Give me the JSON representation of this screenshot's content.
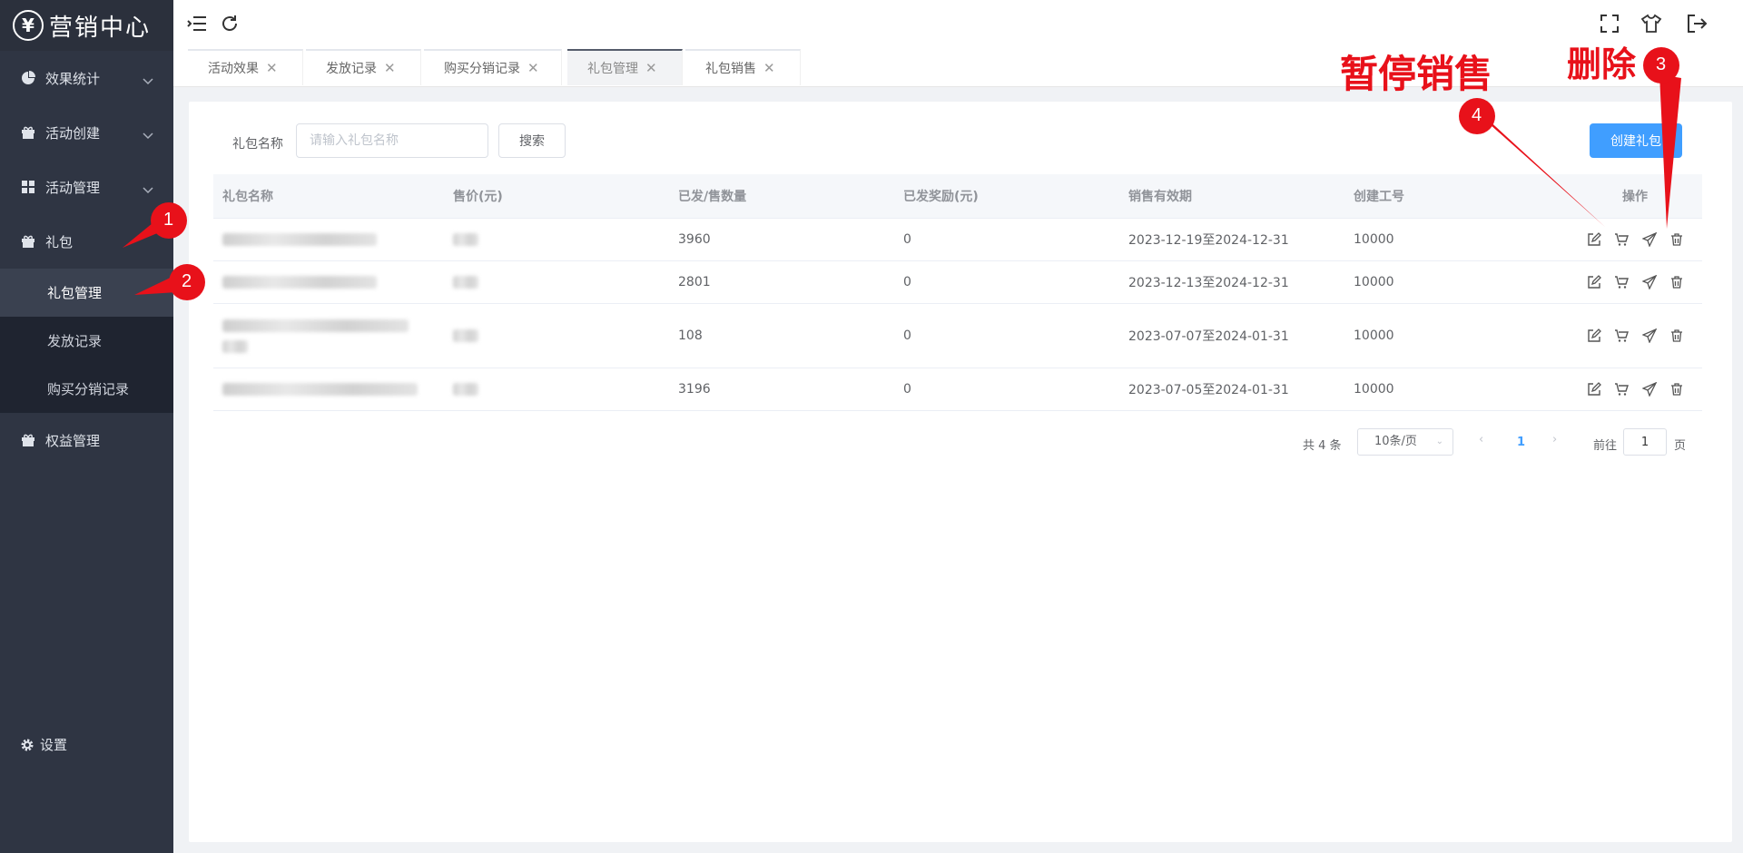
{
  "brand": {
    "logo_glyph": "¥",
    "title": "营销中心"
  },
  "sidebar": {
    "items": [
      {
        "label": "效果统计",
        "icon": "pie-chart-icon"
      },
      {
        "label": "活动创建",
        "icon": "gift-icon"
      },
      {
        "label": "活动管理",
        "icon": "grid-icon"
      },
      {
        "label": "礼包",
        "icon": "gift-icon"
      }
    ],
    "sub_items": [
      {
        "label": "礼包管理",
        "active": true
      },
      {
        "label": "发放记录"
      },
      {
        "label": "购买分销记录"
      }
    ],
    "extra_item": {
      "label": "权益管理",
      "icon": "gift-icon"
    },
    "settings_label": "设置"
  },
  "tabs": [
    {
      "label": "活动效果"
    },
    {
      "label": "发放记录"
    },
    {
      "label": "购买分销记录"
    },
    {
      "label": "礼包管理",
      "active": true
    },
    {
      "label": "礼包销售"
    }
  ],
  "search": {
    "label": "礼包名称",
    "placeholder": "请输入礼包名称",
    "button_label": "搜索",
    "create_label": "创建礼包"
  },
  "table": {
    "columns": [
      "礼包名称",
      "售价(元)",
      "已发/售数量",
      "已发奖励(元)",
      "销售有效期",
      "创建工号",
      "操作"
    ],
    "rows": [
      {
        "sold": "3960",
        "reward": "0",
        "period": "2023-12-19至2024-12-31",
        "creator": "10000"
      },
      {
        "sold": "2801",
        "reward": "0",
        "period": "2023-12-13至2024-12-31",
        "creator": "10000"
      },
      {
        "sold": "108",
        "reward": "0",
        "period": "2023-07-07至2024-01-31",
        "creator": "10000"
      },
      {
        "sold": "3196",
        "reward": "0",
        "period": "2023-07-05至2024-01-31",
        "creator": "10000"
      }
    ]
  },
  "pagination": {
    "total_text": "共 4 条",
    "page_size": "10条/页",
    "current_page": "1",
    "jump_prefix": "前往",
    "jump_value": "1",
    "jump_suffix": "页"
  },
  "annotations": {
    "pause_label": "暂停销售",
    "delete_label": "删除",
    "markers": [
      "1",
      "2",
      "3",
      "4"
    ],
    "color": "#e8111a"
  },
  "colors": {
    "sidebar": "#2f3543",
    "primary": "#409eff"
  }
}
